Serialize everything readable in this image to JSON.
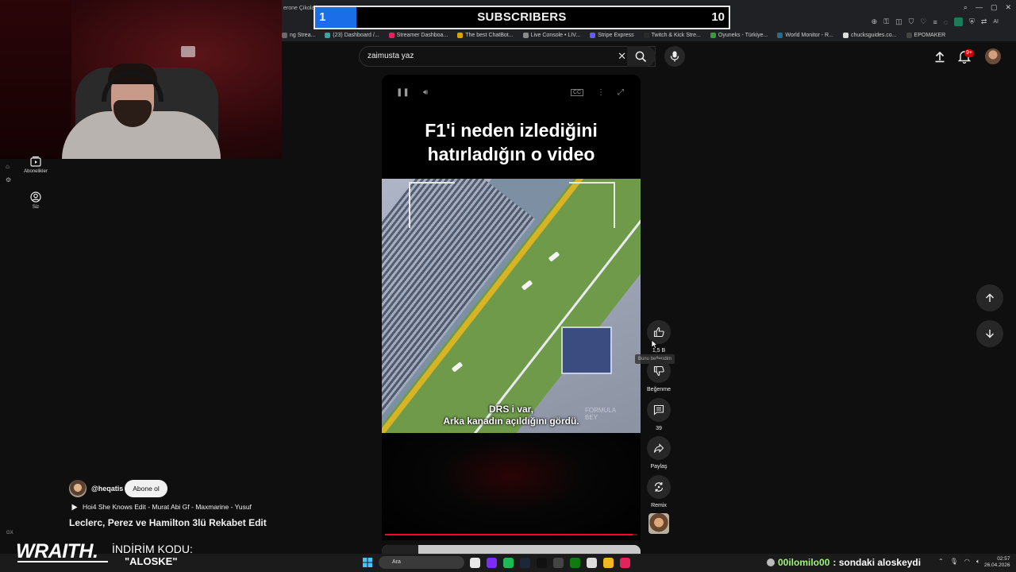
{
  "browser": {
    "partial_tab": "erone Çikolat",
    "bookmarks": [
      {
        "label": "ng Strea...",
        "color": "#6a6a6a"
      },
      {
        "label": "(23) Dashboard /...",
        "color": "#3aa3a3"
      },
      {
        "label": "Streamer Dashboa...",
        "color": "#e0245e"
      },
      {
        "label": "The best ChatBot...",
        "color": "#d9a400"
      },
      {
        "label": "Live Console • LIV...",
        "color": "#8a8a8a"
      },
      {
        "label": "Stripe Express",
        "color": "#635bff"
      },
      {
        "label": "Twitch & Kick Stre...",
        "color": "#2a2a2a"
      },
      {
        "label": "Oyuneks - Türkiye...",
        "color": "#3a9a3a"
      },
      {
        "label": "World Monitor - R...",
        "color": "#2a6a8a"
      },
      {
        "label": "chucksguides.co...",
        "color": "#dddddd"
      },
      {
        "label": "EPOMAKER",
        "color": "#444444"
      }
    ],
    "ai_label": "AI"
  },
  "subscribers": {
    "title": "SUBSCRIBERS",
    "current": "1",
    "goal": "10",
    "progress": 0.1,
    "fill_color": "#1a6ee8"
  },
  "sidebar": {
    "items": [
      {
        "label": "Abonelikler",
        "icon": "subscriptions-icon"
      },
      {
        "label": "Siz",
        "icon": "account-icon"
      }
    ]
  },
  "search": {
    "query": "zaimusta yaz"
  },
  "header": {
    "notification_badge": "9+"
  },
  "video": {
    "headline_line1": "F1'i neden izlediğini",
    "headline_line2": "hatırladığın o video",
    "subtitle_line1": "DRS i var,",
    "subtitle_line2": "Arka kanadın açıldığını gördü.",
    "watermark_line1": "FORMULA",
    "watermark_line2": "BEY",
    "progress": 0.98
  },
  "actions": {
    "like_count": "1,5 B",
    "like_tooltip": "Bunu beğendim",
    "dislike_label": "Beğenme",
    "comment_count": "39",
    "share_label": "Paylaş",
    "remix_label": "Remix"
  },
  "channel": {
    "handle": "@heqatis",
    "subscribe_label": "Abone ol",
    "music": "Hoi4 She Knows Edit - Murat Abi Gf - Maxmarine - Yusuf",
    "title": "Leclerc, Perez ve Hamilton 3lü Rekabet Edit"
  },
  "overlay": {
    "brand": "WRAITH.",
    "promo_label": "İNDİRİM KODU:",
    "promo_code": "\"ALOSKE\"",
    "chat_user": "00ilomilo00",
    "chat_text": ": sondaki aloskeydi",
    "side_mini": "GX"
  },
  "taskbar": {
    "search_placeholder": "Ara",
    "time": "02:57",
    "date": "26.04.2026",
    "app_colors": [
      "#e8e8e8",
      "#7b2cf5",
      "#1db954",
      "#1b2838",
      "#111111",
      "#444444",
      "#107c10",
      "#dddddd",
      "#f3b61f",
      "#e0245e"
    ]
  }
}
